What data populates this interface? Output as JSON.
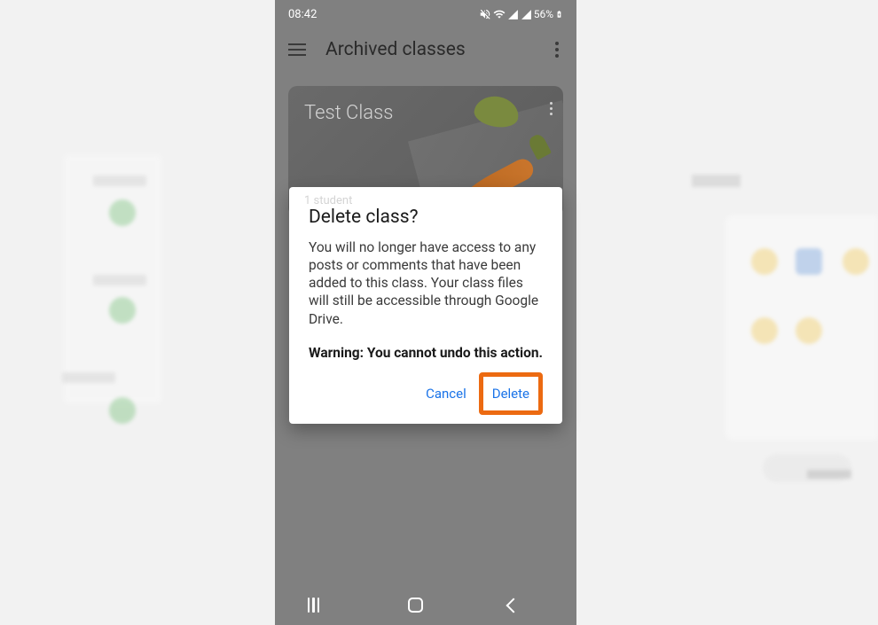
{
  "status": {
    "time": "08:42",
    "battery": "56%",
    "icons": "📵 📶 📶 📶 🔋"
  },
  "app": {
    "title": "Archived classes"
  },
  "class_card": {
    "title": "Test Class",
    "students": "1 student"
  },
  "dialog": {
    "title": "Delete class?",
    "body": "You will no longer have access to any posts or comments that have been added to this class. Your class files will still be accessible through Google Drive.",
    "warning": "Warning: You cannot undo this action.",
    "cancel": "Cancel",
    "delete": "Delete"
  }
}
